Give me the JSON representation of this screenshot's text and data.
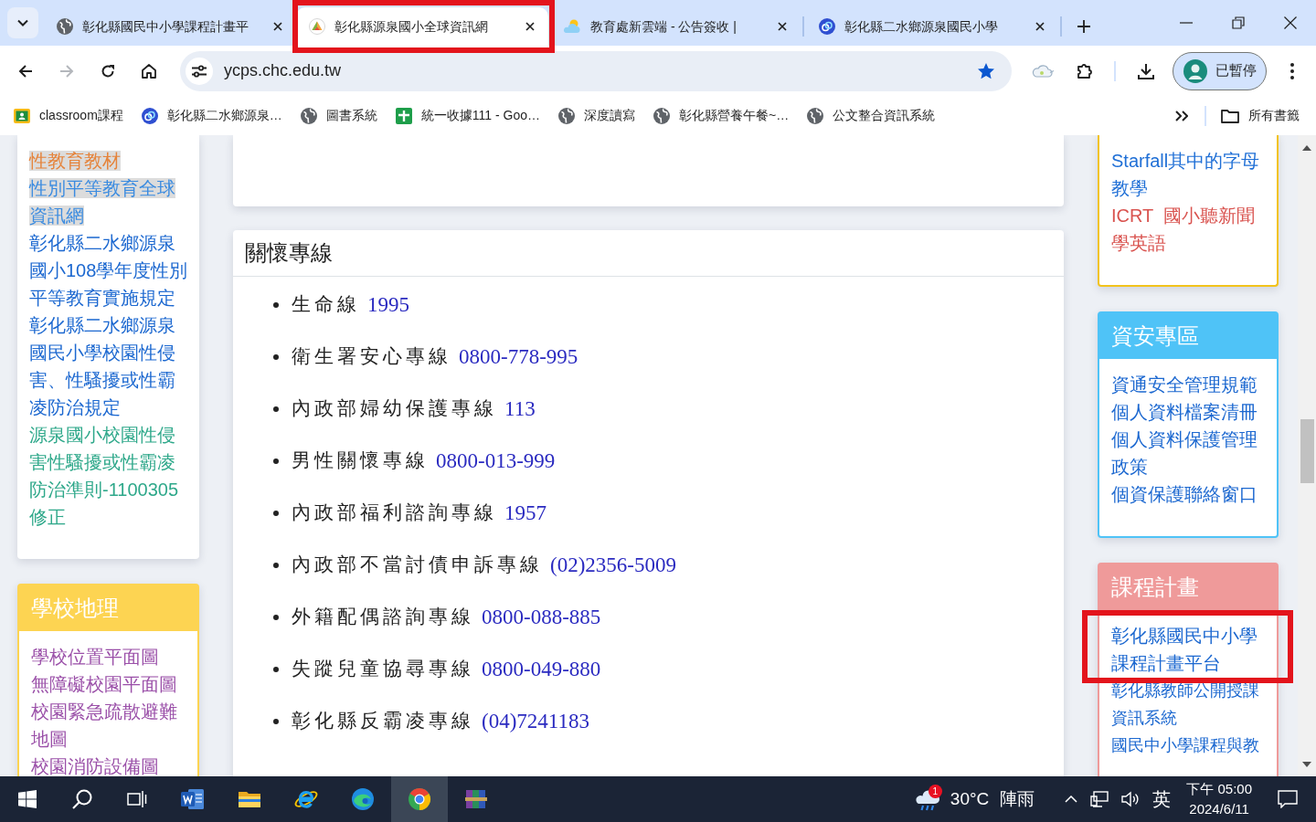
{
  "tab_strip": {
    "tabs": [
      {
        "kind": "globe",
        "title": "彰化縣國民中小學課程計畫平",
        "selected": false,
        "framed": false
      },
      {
        "kind": "triangle",
        "title": "彰化縣源泉國小全球資訊網",
        "selected": true,
        "framed": true
      },
      {
        "kind": "cloud",
        "title": "教育處新雲端 - 公告簽收 |",
        "selected": false,
        "framed": false
      },
      {
        "kind": "rings",
        "title": "彰化縣二水鄉源泉國民小學",
        "selected": false,
        "framed": false
      }
    ]
  },
  "toolbar": {
    "nav_buttons": [
      {
        "kind": "back",
        "disabled": false
      },
      {
        "kind": "forward",
        "disabled": true
      },
      {
        "kind": "reload",
        "disabled": false
      },
      {
        "kind": "home",
        "disabled": false
      }
    ],
    "address": "ycps.chc.edu.tw",
    "bookmarked": true,
    "profile_label": "已暫停"
  },
  "bookmarks_bar": {
    "items": [
      {
        "kind": "classroom",
        "title": "classroom課程"
      },
      {
        "kind": "rings",
        "title": "彰化縣二水鄉源泉…"
      },
      {
        "kind": "globe",
        "title": "圖書系統"
      },
      {
        "kind": "sheets",
        "title": "統一收據111 - Goo…"
      },
      {
        "kind": "globe",
        "title": "深度讀寫"
      },
      {
        "kind": "globe",
        "title": "彰化縣營養午餐~…"
      },
      {
        "kind": "globe",
        "title": "公文整合資訊系統"
      }
    ],
    "all_bookmarks": "所有書籤"
  },
  "page": {
    "left_column": [
      {
        "items": [
          {
            "text": "性教育教材",
            "color": "#e5833a",
            "highlighted": true
          },
          {
            "text": "性別平等教育全球資訊網",
            "color": "#3a8be0",
            "highlighted": true
          },
          {
            "text": "彰化縣二水鄉源泉國小108學年度性別平等教育實施規定",
            "color": "#1c68d0",
            "highlighted": false
          },
          {
            "text": "彰化縣二水鄉源泉國民小學校園性侵害、性騷擾或性霸凌防治規定",
            "color": "#1c68d0",
            "highlighted": false
          },
          {
            "text": "源泉國小校園性侵害性騷擾或性霸凌防治準則-1100305修正",
            "color": "#2ea88a",
            "highlighted": false
          }
        ]
      },
      {
        "title": "學校地理",
        "color": "#fdd452",
        "items": [
          {
            "text": "學校位置平面圖",
            "color": "#9a4fa8"
          },
          {
            "text": "無障礙校園平面圖",
            "color": "#9a4fa8"
          },
          {
            "text": "校園緊急疏散避難地圖",
            "color": "#9a4fa8"
          },
          {
            "text": "校園消防設備圖",
            "color": "#9a4fa8"
          }
        ]
      }
    ],
    "hotlines": {
      "title": "關懷專線",
      "items": [
        {
          "label": "生命線",
          "number": "1995"
        },
        {
          "label": "衛生署安心專線",
          "number": "0800-778-995"
        },
        {
          "label": "內政部婦幼保護專線",
          "number": "113"
        },
        {
          "label": "男性關懷專線",
          "number": "0800-013-999"
        },
        {
          "label": "內政部福利諮詢專線",
          "number": "1957"
        },
        {
          "label": "內政部不當討債申訴專線",
          "number": "(02)2356-5009"
        },
        {
          "label": "外籍配偶諮詢專線",
          "number": "0800-088-885"
        },
        {
          "label": "失蹤兒童協尋專線",
          "number": "0800-049-880"
        },
        {
          "label": "彰化縣反霸凌專線",
          "number": "(04)7241183"
        }
      ]
    },
    "right_column": [
      {
        "color": "#f2c31c",
        "items": [
          {
            "text": "Starfall其中的字母教學",
            "color": "#1f6fd6"
          },
          {
            "text": "ICRT  國小聽新聞學英語",
            "color": "#d9534f"
          }
        ]
      },
      {
        "title": "資安專區",
        "color": "#4fc3f7",
        "items": [
          {
            "text": "資通安全管理規範"
          },
          {
            "text": "個人資料檔案清冊"
          },
          {
            "text": "個人資料保護管理政策"
          },
          {
            "text": "個資保護聯絡窗口"
          }
        ]
      },
      {
        "title": "課程計畫",
        "color": "#ef9a9a",
        "items": [
          {
            "text": "彰化縣國民中小學課程計畫平台",
            "framed": true
          },
          {
            "text": "彰化縣教師公開授課資訊系統",
            "framed": false
          },
          {
            "text": "國民中小學課程與教",
            "framed": false
          }
        ]
      }
    ]
  },
  "taskbar": {
    "apps": [
      {
        "kind": "start",
        "active": false
      },
      {
        "kind": "search",
        "active": false
      },
      {
        "kind": "task_view",
        "active": false
      },
      {
        "kind": "word",
        "active": false
      },
      {
        "kind": "explorer",
        "active": false
      },
      {
        "kind": "ie",
        "active": false
      },
      {
        "kind": "edge",
        "active": false
      },
      {
        "kind": "chrome",
        "active": true
      },
      {
        "kind": "archive",
        "active": false
      }
    ],
    "weather": {
      "badge": "1",
      "temperature": "30°C",
      "condition": "陣雨"
    },
    "input_method": "英",
    "time": "下午 05:00",
    "date": "2024/6/11"
  }
}
